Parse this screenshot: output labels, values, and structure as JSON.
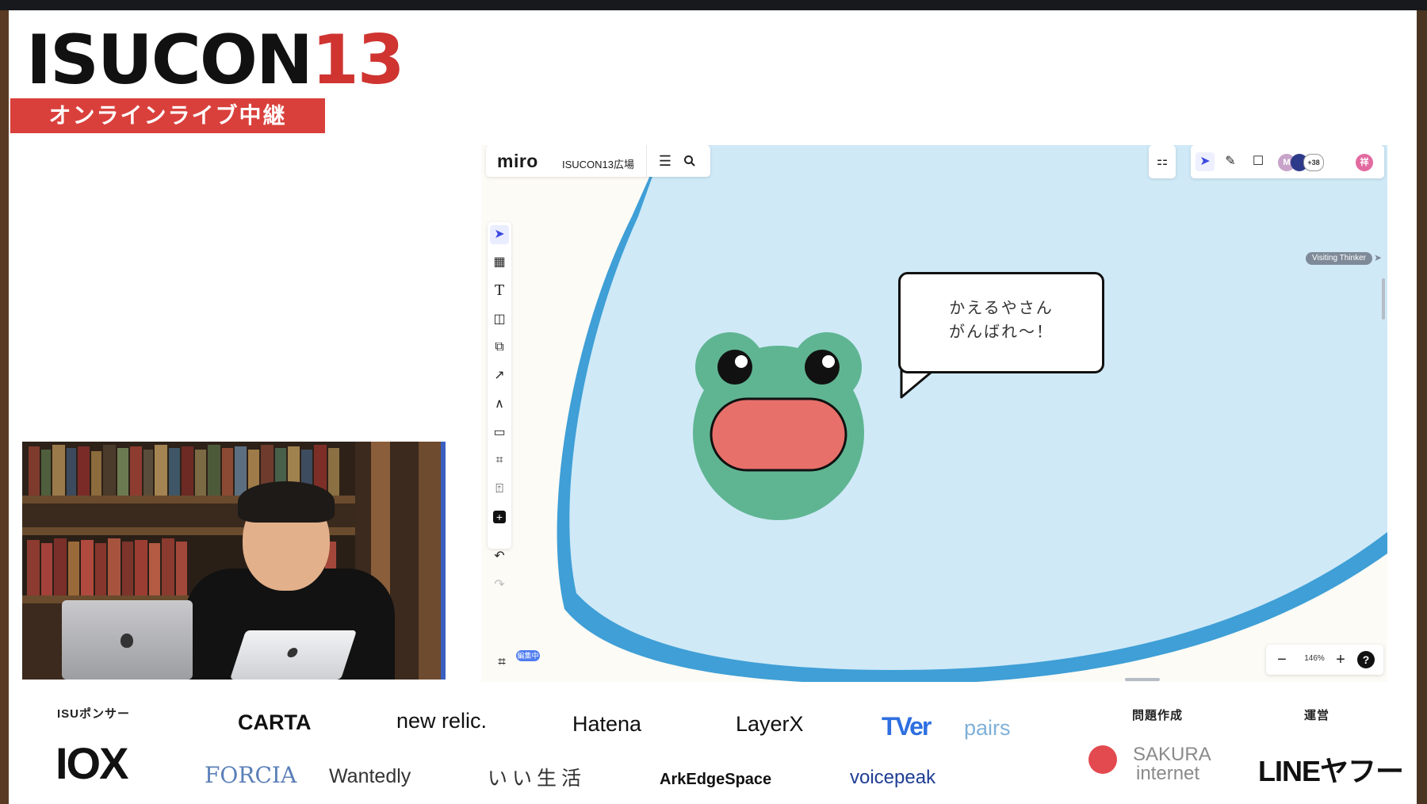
{
  "event": {
    "logo_main": "ISUCON",
    "logo_num": "13",
    "logo_subtitle": "オンラインライブ中継"
  },
  "miro": {
    "logo": "miro",
    "board_name": "ISUCON13広場",
    "avatar_initial": "M",
    "participant_count": "+38",
    "self_initial": "祥",
    "visiting_label": "Visiting Thinker",
    "speech_line1": "かえるやさん",
    "speech_line2": "がんばれ〜！",
    "tag": "編集中",
    "zoom_level": "146%",
    "zoom_minus": "−",
    "zoom_plus": "+",
    "help": "?",
    "colors": {
      "sky": "#cfe9f7",
      "frog": "#5fb592",
      "mouth": "#e8706a",
      "accent": "#3d4ae0"
    }
  },
  "sponsors": {
    "isu_heading": "ISUポンサー",
    "main_sponsor": "IOX",
    "row1": [
      "CARTA",
      "new relic.",
      "Hatena",
      "LayerX",
      "TVer",
      "pairs"
    ],
    "row2": [
      "FORCIA",
      "Wantedly",
      "いい生活",
      "ArkEdgeSpace",
      "voicepeak"
    ],
    "problem_heading": "問題作成",
    "problem_line1": "SAKURA",
    "problem_line2": "internet",
    "operator_heading": "運営",
    "operator": "LINEヤフー"
  }
}
